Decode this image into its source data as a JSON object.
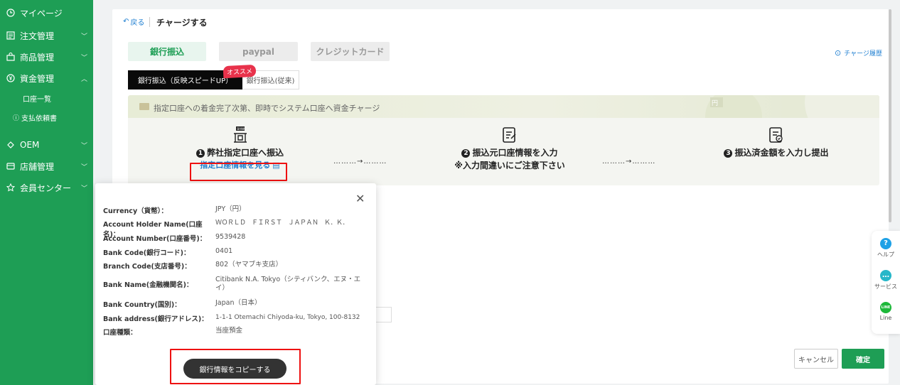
{
  "sidebar": {
    "items": [
      {
        "label": "マイページ",
        "icon": "clock-icon"
      },
      {
        "label": "注文管理",
        "icon": "order-icon"
      },
      {
        "label": "商品管理",
        "icon": "bag-icon"
      },
      {
        "label": "資金管理",
        "icon": "yen-icon"
      },
      {
        "label": "OEM",
        "icon": "oem-icon"
      },
      {
        "label": "店舗管理",
        "icon": "store-icon"
      },
      {
        "label": "会員センター",
        "icon": "star-icon"
      }
    ],
    "sub_items": [
      {
        "label": "口座一覧"
      },
      {
        "label": "支払依頼書"
      }
    ]
  },
  "header": {
    "back_label": "戻る",
    "title": "チャージする"
  },
  "tabs": [
    {
      "label": "銀行振込"
    },
    {
      "label": "paypal"
    },
    {
      "label": "クレジットカード"
    }
  ],
  "history_label": "チャージ履歴",
  "subtabs": [
    {
      "label": "銀行振込（反映スピードUP）"
    },
    {
      "label": "銀行振込(従来)"
    }
  ],
  "badge": "オススメ",
  "banner": {
    "text": "指定口座への着金完了次第、即時でシステム口座へ資金チャージ"
  },
  "steps": [
    {
      "num": "1",
      "title": "弊社指定口座へ振込",
      "link": "指定口座情報を見る"
    },
    {
      "num": "2",
      "title": "振込元口座情報を入力",
      "note": "※入力間違いにご注意下さい"
    },
    {
      "num": "3",
      "title": "振込済金額を入力し提出"
    }
  ],
  "popup": {
    "rows": [
      {
        "key": "Currency（貨幣）：",
        "value": "JPY（円）"
      },
      {
        "key": "Account Holder Name(口座名)：",
        "value": "ＷＯＲＬＤ　ＦＩＲＳＴ　ＪＡＰＡＮ　Ｋ．Ｋ．"
      },
      {
        "key": "Account Number(口座番号)：",
        "value": "9539428"
      },
      {
        "key": "Bank Code(銀行コード)：",
        "value": "0401"
      },
      {
        "key": "Branch Code(支店番号)：",
        "value": "802（ヤマブキ支店）"
      },
      {
        "key": "Bank Name(金融機関名)：",
        "value": "Citibank N.A. Tokyo（シティバンク、エヌ・エイ）"
      },
      {
        "key": "Bank Country(国別)：",
        "value": "Japan（日本）"
      },
      {
        "key": "Bank address(銀行アドレス)：",
        "value": "1-1-1 Otemachi Chiyoda-ku, Tokyo, 100-8132"
      },
      {
        "key": "口座種類：",
        "value": "当座預金"
      }
    ],
    "copy_label": "銀行情報をコピーする"
  },
  "footer": {
    "cancel_label": "キャンセル",
    "confirm_label": "確定"
  },
  "float_bar": [
    {
      "label": "ヘルプ",
      "icon": "help-icon",
      "glyph": "?"
    },
    {
      "label": "サービス",
      "icon": "service-icon",
      "glyph": "…"
    },
    {
      "label": "Line",
      "icon": "line-icon",
      "glyph": "LINE"
    }
  ],
  "colors": {
    "brand": "#1e9e55",
    "link": "#1f7fd1",
    "highlight": "#e11111",
    "badge": "#e8324b"
  }
}
